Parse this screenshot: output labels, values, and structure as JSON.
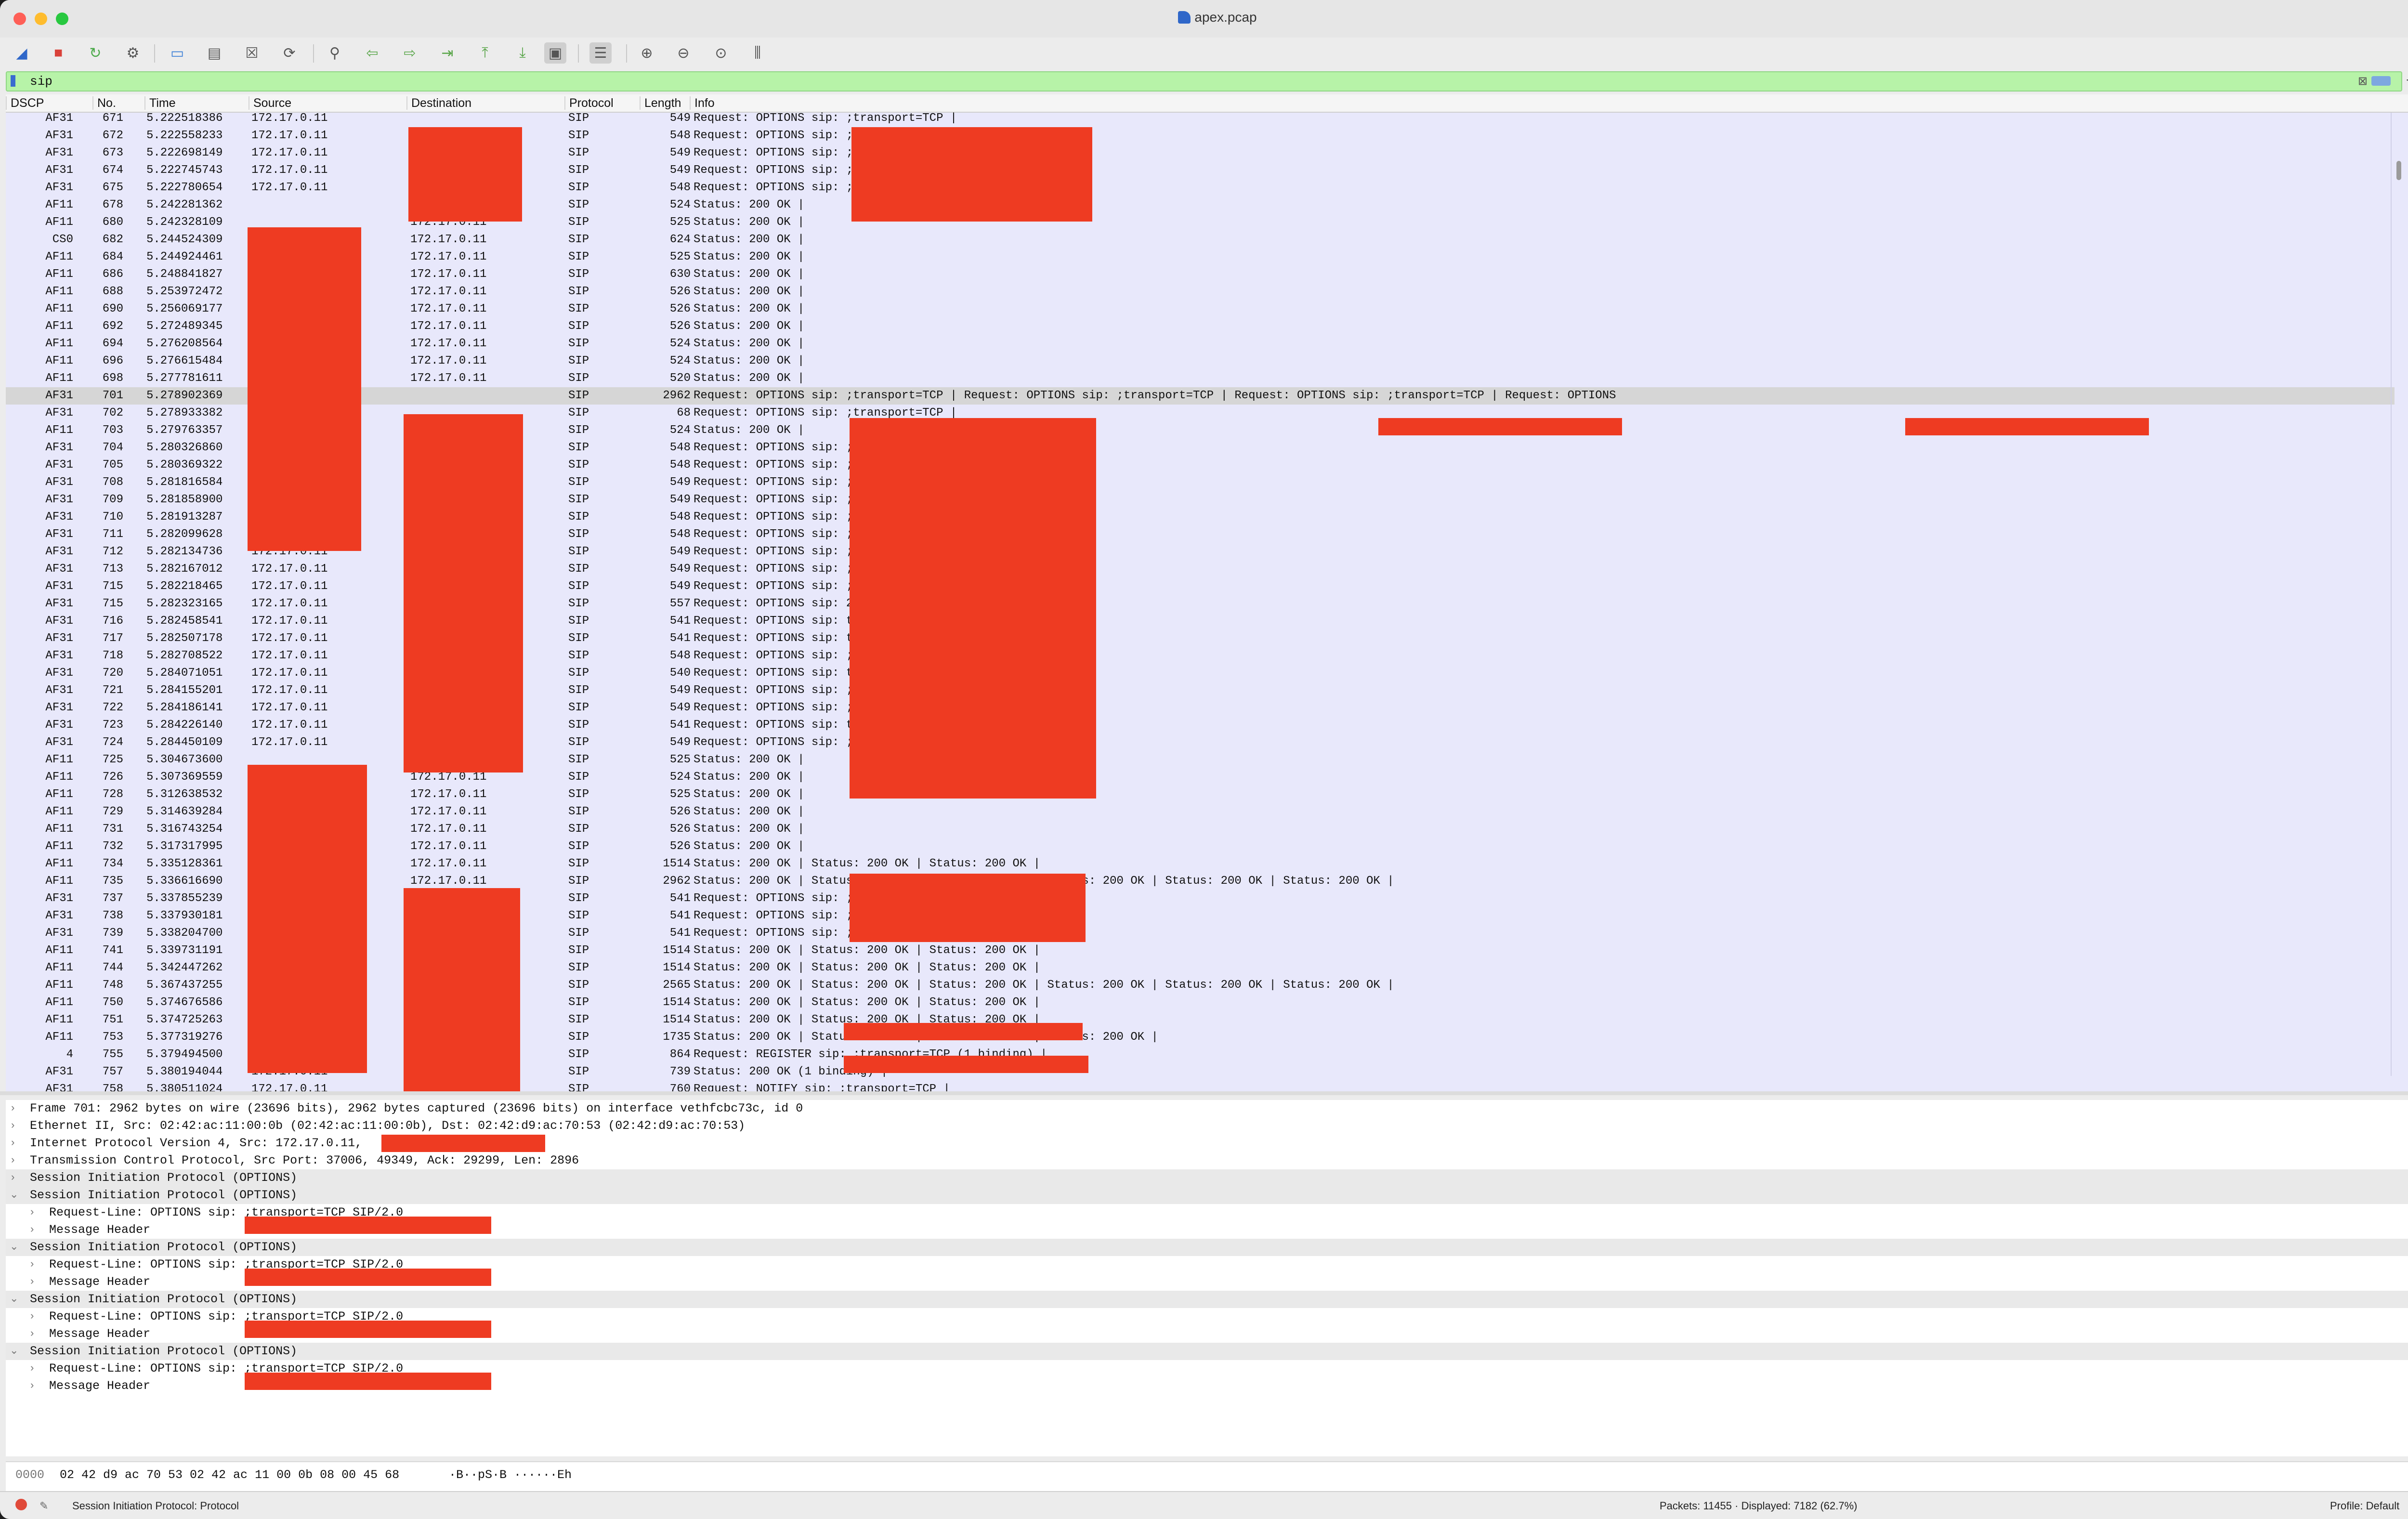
{
  "window": {
    "title": "apex.pcap"
  },
  "toolbar": {
    "icons": [
      "shark-fin-icon",
      "stop-icon",
      "restart-icon",
      "options-gear-icon",
      "open-folder-icon",
      "save-icon",
      "close-file-icon",
      "reload-icon",
      "find-icon",
      "back-arrow-icon",
      "forward-arrow-icon",
      "go-to-packet-icon",
      "first-packet-icon",
      "last-packet-icon",
      "auto-scroll-icon",
      "colorize-icon",
      "zoom-in-icon",
      "zoom-out-icon",
      "normal-size-icon",
      "resize-columns-icon"
    ]
  },
  "filter": {
    "value": "sip"
  },
  "columns": [
    "DSCP",
    "No.",
    "Time",
    "Source",
    "Destination",
    "Protocol",
    "Length",
    "Info"
  ],
  "packets": [
    [
      "AF31",
      "671",
      "5.222518386",
      "172.17.0.11",
      "",
      "SIP",
      "549",
      "Request: OPTIONS sip:                         ;transport=TCP |"
    ],
    [
      "AF31",
      "672",
      "5.222558233",
      "172.17.0.11",
      "",
      "SIP",
      "548",
      "Request: OPTIONS sip:                         ;transport=TCP |"
    ],
    [
      "AF31",
      "673",
      "5.222698149",
      "172.17.0.11",
      "",
      "SIP",
      "549",
      "Request: OPTIONS sip:                         ;transport=TCP |"
    ],
    [
      "AF31",
      "674",
      "5.222745743",
      "172.17.0.11",
      "",
      "SIP",
      "549",
      "Request: OPTIONS sip:                         ;transport=TCP |"
    ],
    [
      "AF31",
      "675",
      "5.222780654",
      "172.17.0.11",
      "",
      "SIP",
      "548",
      "Request: OPTIONS sip:                         ;transport=TCP |"
    ],
    [
      "AF11",
      "678",
      "5.242281362",
      "",
      "172.17.0.11",
      "SIP",
      "524",
      "Status: 200 OK |"
    ],
    [
      "AF11",
      "680",
      "5.242328109",
      "",
      "172.17.0.11",
      "SIP",
      "525",
      "Status: 200 OK |"
    ],
    [
      "CS0",
      "682",
      "5.244524309",
      "",
      "172.17.0.11",
      "SIP",
      "624",
      "Status: 200 OK |"
    ],
    [
      "AF11",
      "684",
      "5.244924461",
      "",
      "172.17.0.11",
      "SIP",
      "525",
      "Status: 200 OK |"
    ],
    [
      "AF11",
      "686",
      "5.248841827",
      "",
      "172.17.0.11",
      "SIP",
      "630",
      "Status: 200 OK |"
    ],
    [
      "AF11",
      "688",
      "5.253972472",
      "",
      "172.17.0.11",
      "SIP",
      "526",
      "Status: 200 OK |"
    ],
    [
      "AF11",
      "690",
      "5.256069177",
      "",
      "172.17.0.11",
      "SIP",
      "526",
      "Status: 200 OK |"
    ],
    [
      "AF11",
      "692",
      "5.272489345",
      "",
      "172.17.0.11",
      "SIP",
      "526",
      "Status: 200 OK |"
    ],
    [
      "AF11",
      "694",
      "5.276208564",
      "",
      "172.17.0.11",
      "SIP",
      "524",
      "Status: 200 OK |"
    ],
    [
      "AF11",
      "696",
      "5.276615484",
      "",
      "172.17.0.11",
      "SIP",
      "524",
      "Status: 200 OK |"
    ],
    [
      "AF11",
      "698",
      "5.277781611",
      "",
      "172.17.0.11",
      "SIP",
      "520",
      "Status: 200 OK |"
    ],
    [
      "AF31",
      "701",
      "5.278902369",
      "",
      "",
      "SIP",
      "2962",
      "Request: OPTIONS sip:                         ;transport=TCP | Request: OPTIONS sip:                         ;transport=TCP | Request: OPTIONS sip:                         ;transport=TCP | Request: OPTIONS"
    ],
    [
      "AF31",
      "702",
      "5.278933382",
      "",
      "",
      "SIP",
      "68",
      "Request: OPTIONS sip:                         ;transport=TCP |"
    ],
    [
      "AF11",
      "703",
      "5.279763357",
      "",
      "",
      "SIP",
      "524",
      "Status: 200 OK |"
    ],
    [
      "AF31",
      "704",
      "5.280326860",
      "172.17.0.11",
      "",
      "SIP",
      "548",
      "Request: OPTIONS sip:                         ;transport=TCP |"
    ],
    [
      "AF31",
      "705",
      "5.280369322",
      "172.17.0.11",
      "",
      "SIP",
      "548",
      "Request: OPTIONS sip:                         ;transport=TCP |"
    ],
    [
      "AF31",
      "708",
      "5.281816584",
      "172.17.0.11",
      "",
      "SIP",
      "549",
      "Request: OPTIONS sip:                         ;transport=TCP |"
    ],
    [
      "AF31",
      "709",
      "5.281858900",
      "172.17.0.11",
      "",
      "SIP",
      "549",
      "Request: OPTIONS sip:                         ;transport=TCP |"
    ],
    [
      "AF31",
      "710",
      "5.281913287",
      "172.17.0.11",
      "",
      "SIP",
      "548",
      "Request: OPTIONS sip:                         ;transport=TCP |"
    ],
    [
      "AF31",
      "711",
      "5.282099628",
      "172.17.0.11",
      "",
      "SIP",
      "548",
      "Request: OPTIONS sip:                         ;transport=TCP |"
    ],
    [
      "AF31",
      "712",
      "5.282134736",
      "172.17.0.11",
      "",
      "SIP",
      "549",
      "Request: OPTIONS sip:                         ;transport=TCP |"
    ],
    [
      "AF31",
      "713",
      "5.282167012",
      "172.17.0.11",
      "",
      "SIP",
      "549",
      "Request: OPTIONS sip:                         ;transport=TCP |"
    ],
    [
      "AF31",
      "715",
      "5.282218465",
      "172.17.0.11",
      "",
      "SIP",
      "549",
      "Request: OPTIONS sip:                         ;transport=TCP |"
    ],
    [
      "AF31",
      "715",
      "5.282323165",
      "172.17.0.11",
      "",
      "SIP",
      "557",
      "Request: OPTIONS sip:                         2;transport=TCP |"
    ],
    [
      "AF31",
      "716",
      "5.282458541",
      "172.17.0.11",
      "",
      "SIP",
      "541",
      "Request: OPTIONS sip:                         transport=TCP |"
    ],
    [
      "AF31",
      "717",
      "5.282507178",
      "172.17.0.11",
      "",
      "SIP",
      "541",
      "Request: OPTIONS sip:                         transport=TCP |"
    ],
    [
      "AF31",
      "718",
      "5.282708522",
      "172.17.0.11",
      "",
      "SIP",
      "548",
      "Request: OPTIONS sip:                         ;transport=TCP |"
    ],
    [
      "AF31",
      "720",
      "5.284071051",
      "172.17.0.11",
      "",
      "SIP",
      "540",
      "Request: OPTIONS sip:                         transport=TCP |"
    ],
    [
      "AF31",
      "721",
      "5.284155201",
      "172.17.0.11",
      "",
      "SIP",
      "549",
      "Request: OPTIONS sip:                         ;transport=TCP |"
    ],
    [
      "AF31",
      "722",
      "5.284186141",
      "172.17.0.11",
      "",
      "SIP",
      "549",
      "Request: OPTIONS sip:                         ;transport=TCP |"
    ],
    [
      "AF31",
      "723",
      "5.284226140",
      "172.17.0.11",
      "",
      "SIP",
      "541",
      "Request: OPTIONS sip:                         transport=TCP |"
    ],
    [
      "AF31",
      "724",
      "5.284450109",
      "172.17.0.11",
      "",
      "SIP",
      "549",
      "Request: OPTIONS sip:                         ;transport=TCP |"
    ],
    [
      "AF11",
      "725",
      "5.304673600",
      "",
      "172.17.0.11",
      "SIP",
      "525",
      "Status: 200 OK |"
    ],
    [
      "AF11",
      "726",
      "5.307369559",
      "",
      "172.17.0.11",
      "SIP",
      "524",
      "Status: 200 OK |"
    ],
    [
      "AF11",
      "728",
      "5.312638532",
      "",
      "172.17.0.11",
      "SIP",
      "525",
      "Status: 200 OK |"
    ],
    [
      "AF11",
      "729",
      "5.314639284",
      "",
      "172.17.0.11",
      "SIP",
      "526",
      "Status: 200 OK |"
    ],
    [
      "AF11",
      "731",
      "5.316743254",
      "",
      "172.17.0.11",
      "SIP",
      "526",
      "Status: 200 OK |"
    ],
    [
      "AF11",
      "732",
      "5.317317995",
      "",
      "172.17.0.11",
      "SIP",
      "526",
      "Status: 200 OK |"
    ],
    [
      "AF11",
      "734",
      "5.335128361",
      "",
      "172.17.0.11",
      "SIP",
      "1514",
      "Status: 200 OK | Status: 200 OK | Status: 200 OK |"
    ],
    [
      "AF11",
      "735",
      "5.336616690",
      "",
      "172.17.0.11",
      "SIP",
      "2962",
      "Status: 200 OK | Status: 200 OK | Status: 200 OK | Status: 200 OK | Status: 200 OK | Status: 200 OK |"
    ],
    [
      "AF31",
      "737",
      "5.337855239",
      "",
      "",
      "SIP",
      "541",
      "Request: OPTIONS sip:                        ;transport=TCP |"
    ],
    [
      "AF31",
      "738",
      "5.337930181",
      "",
      "",
      "SIP",
      "541",
      "Request: OPTIONS sip:                        ;transport=TCP |"
    ],
    [
      "AF31",
      "739",
      "5.338204700",
      "",
      "",
      "SIP",
      "541",
      "Request: OPTIONS sip:                        ;transport=TCP |"
    ],
    [
      "AF11",
      "741",
      "5.339731191",
      "",
      "",
      "SIP",
      "1514",
      "Status: 200 OK | Status: 200 OK | Status: 200 OK |"
    ],
    [
      "AF11",
      "744",
      "5.342447262",
      "",
      "",
      "SIP",
      "1514",
      "Status: 200 OK | Status: 200 OK | Status: 200 OK |"
    ],
    [
      "AF11",
      "748",
      "5.367437255",
      "",
      "",
      "SIP",
      "2565",
      "Status: 200 OK | Status: 200 OK | Status: 200 OK | Status: 200 OK | Status: 200 OK | Status: 200 OK |"
    ],
    [
      "AF11",
      "750",
      "5.374676586",
      "",
      "",
      "SIP",
      "1514",
      "Status: 200 OK | Status: 200 OK | Status: 200 OK |"
    ],
    [
      "AF11",
      "751",
      "5.374725263",
      "",
      "",
      "SIP",
      "1514",
      "Status: 200 OK | Status: 200 OK | Status: 200 OK |"
    ],
    [
      "AF11",
      "753",
      "5.377319276",
      "",
      "",
      "SIP",
      "1735",
      "Status: 200 OK | Status: 200 OK | Status: 200 OK | Status: 200 OK |"
    ],
    [
      "4",
      "755",
      "5.379494500",
      "",
      "",
      "SIP",
      "864",
      "Request: REGISTER sip:                       ;transport=TCP  (1 binding) |"
    ],
    [
      "AF31",
      "757",
      "5.380194044",
      "172.17.0.11",
      "",
      "SIP",
      "739",
      "Status: 200 OK  (1 binding) |"
    ],
    [
      "AF31",
      "758",
      "5.380511024",
      "172.17.0.11",
      "",
      "SIP",
      "760",
      "Request: NOTIFY sip:                         ;transport=TCP |"
    ]
  ],
  "selected_packet": "701",
  "details": [
    {
      "exp": "closed",
      "text": "Frame 701: 2962 bytes on wire (23696 bits), 2962 bytes captured (23696 bits) on interface vethfcbc73c, id 0",
      "indent": 0
    },
    {
      "exp": "closed",
      "text": "Ethernet II, Src: 02:42:ac:11:00:0b (02:42:ac:11:00:0b), Dst: 02:42:d9:ac:70:53 (02:42:d9:ac:70:53)",
      "indent": 0
    },
    {
      "exp": "closed",
      "text": "Internet Protocol Version 4, Src: 172.17.0.11,",
      "indent": 0
    },
    {
      "exp": "closed",
      "text": "Transmission Control Protocol, Src Port: 37006,                 49349, Ack: 29299, Len: 2896",
      "indent": 0
    },
    {
      "exp": "closed",
      "text": "Session Initiation Protocol (OPTIONS)",
      "indent": 0
    },
    {
      "exp": "open",
      "text": "Session Initiation Protocol (OPTIONS)",
      "indent": 0
    },
    {
      "exp": "closed",
      "text": "Request-Line: OPTIONS sip:                         ;transport=TCP SIP/2.0",
      "indent": 1
    },
    {
      "exp": "closed",
      "text": "Message Header",
      "indent": 1
    },
    {
      "exp": "open",
      "text": "Session Initiation Protocol (OPTIONS)",
      "indent": 0
    },
    {
      "exp": "closed",
      "text": "Request-Line: OPTIONS sip:                         ;transport=TCP SIP/2.0",
      "indent": 1
    },
    {
      "exp": "closed",
      "text": "Message Header",
      "indent": 1
    },
    {
      "exp": "open",
      "text": "Session Initiation Protocol (OPTIONS)",
      "indent": 0
    },
    {
      "exp": "closed",
      "text": "Request-Line: OPTIONS sip:                         ;transport=TCP SIP/2.0",
      "indent": 1
    },
    {
      "exp": "closed",
      "text": "Message Header",
      "indent": 1
    },
    {
      "exp": "open",
      "text": "Session Initiation Protocol (OPTIONS)",
      "indent": 0
    },
    {
      "exp": "closed",
      "text": "Request-Line: OPTIONS sip:                         ;transport=TCP SIP/2.0",
      "indent": 1
    },
    {
      "exp": "closed",
      "text": "Message Header",
      "indent": 1
    }
  ],
  "bytes": {
    "offset": "0000",
    "hex": "02 42 d9 ac 70 53 02 42  ac 11 00 0b 08 00 45 68",
    "ascii": "·B··pS·B ······Eh"
  },
  "status": {
    "field": "Session Initiation Protocol: Protocol",
    "packets": "Packets: 11455 · Displayed: 7182 (62.7%)",
    "profile": "Profile: Default"
  },
  "colors": {
    "row_bg": "#e8e8fb",
    "selected_bg": "#d6d6d6",
    "redaction": "#ee3b22",
    "filter_ok": "#b7f3a8"
  }
}
